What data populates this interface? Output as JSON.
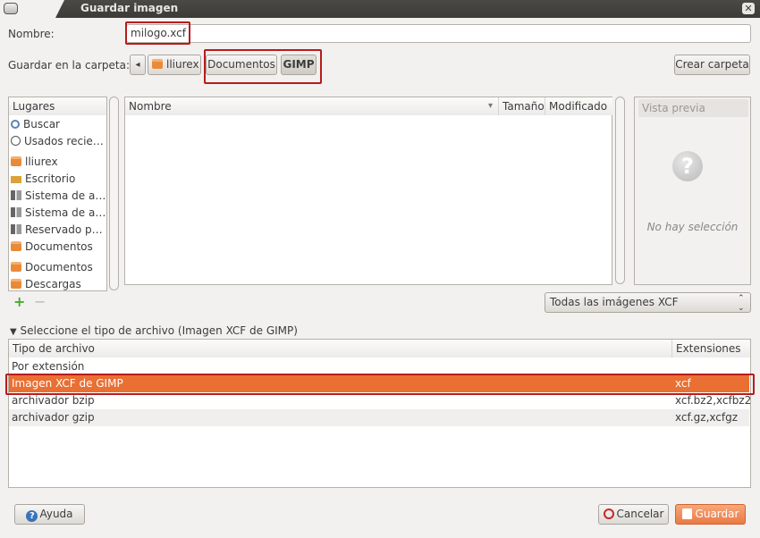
{
  "window": {
    "title": "Guardar imagen",
    "close_glyph": "✕"
  },
  "name_field": {
    "label": "Nombre:",
    "value": "milogo.xcf"
  },
  "folder": {
    "label": "Guardar en la carpeta:",
    "back_glyph": "◂",
    "path": [
      "lliurex",
      "Documentos",
      "GIMP"
    ],
    "create_button": "Crear carpeta"
  },
  "places": {
    "header": "Lugares",
    "items": [
      {
        "label": "Buscar",
        "icon": "search-icon"
      },
      {
        "label": "Usados recie…",
        "icon": "recent-icon"
      },
      {
        "label": "lliurex",
        "icon": "home-folder-icon"
      },
      {
        "label": "Escritorio",
        "icon": "desktop-icon"
      },
      {
        "label": "Sistema de a…",
        "icon": "drive-icon"
      },
      {
        "label": "Sistema de a…",
        "icon": "drive-icon"
      },
      {
        "label": "Reservado p…",
        "icon": "drive-icon"
      },
      {
        "label": "Documentos",
        "icon": "folder-icon"
      },
      {
        "label": "Documentos",
        "icon": "folder-icon"
      },
      {
        "label": "Descargas",
        "icon": "folder-icon"
      }
    ],
    "add_glyph": "+",
    "remove_glyph": "−"
  },
  "files": {
    "columns": {
      "name": "Nombre",
      "size": "Tamaño",
      "modified": "Modificado"
    },
    "sort_glyph": "▾"
  },
  "preview": {
    "title": "Vista previa",
    "empty_text": "No hay selección",
    "question_glyph": "?"
  },
  "filter": {
    "selected": "Todas las imágenes XCF",
    "spin_glyph": "⌃⌄"
  },
  "filetype": {
    "expander_glyph": "▼",
    "expander_label": "Seleccione el tipo de archivo (Imagen XCF de GIMP)",
    "columns": {
      "type": "Tipo de archivo",
      "ext": "Extensiones"
    },
    "rows": [
      {
        "type": "Por extensión",
        "ext": ""
      },
      {
        "type": "Imagen XCF de GIMP",
        "ext": "xcf"
      },
      {
        "type": "archivador bzip",
        "ext": "xcf.bz2,xcfbz2"
      },
      {
        "type": "archivador gzip",
        "ext": "xcf.gz,xcfgz"
      }
    ],
    "selected_index": 1
  },
  "buttons": {
    "help": "Ayuda",
    "cancel": "Cancelar",
    "save": "Guardar"
  },
  "colors": {
    "selection": "#ea6f32",
    "highlight_box": "#b71c1c"
  }
}
